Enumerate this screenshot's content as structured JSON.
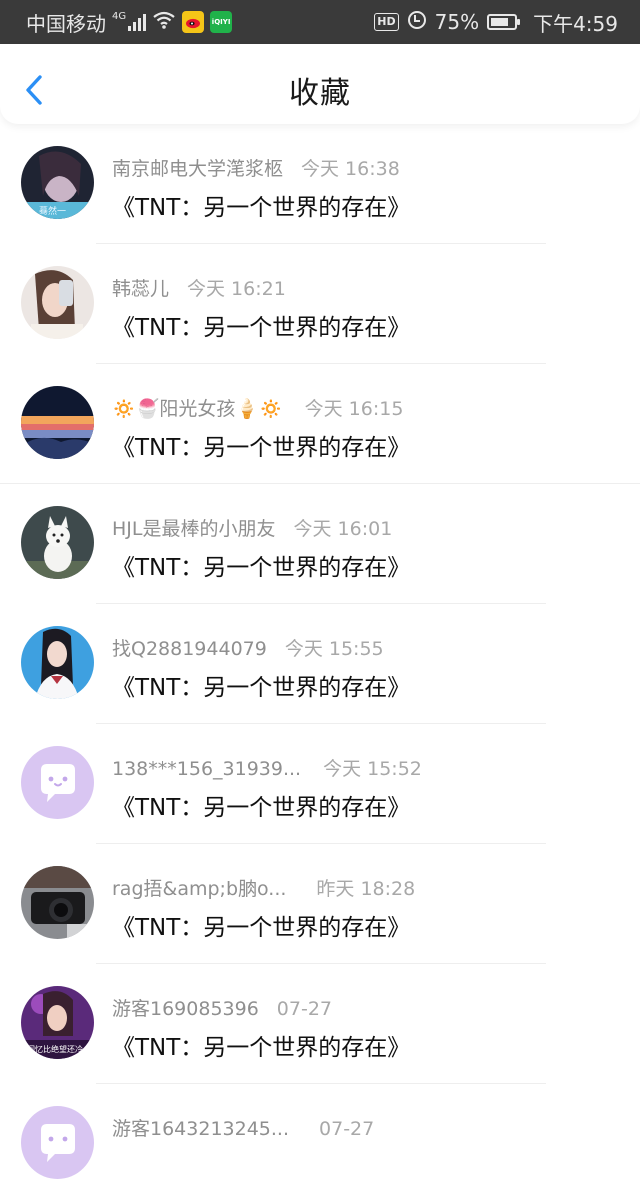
{
  "status_bar": {
    "carrier": "中国移动",
    "network": "4G",
    "battery_percent": "75%",
    "battery_level": 0.75,
    "time": "下午4:59",
    "hd_label": "HD",
    "iqiyi_label": "iQIYI"
  },
  "header": {
    "back_icon": "chevron-left-icon",
    "title": "收藏"
  },
  "favorites": [
    {
      "user": "南京邮电大学滗浆柩",
      "time": "今天 16:38",
      "title": "《TNT：另一个世界的存在》",
      "avatar": "photo-dark"
    },
    {
      "user": "韩蕊儿",
      "time": "今天 16:21",
      "title": "《TNT：另一个世界的存在》",
      "avatar": "photo-light"
    },
    {
      "user": "🔅🍧阳光女孩🍦🔅",
      "time": "今天 16:15",
      "title": "《TNT：另一个世界的存在》",
      "avatar": "photo-sunset"
    },
    {
      "user": "HJL是最棒的小朋友",
      "time": "今天 16:01",
      "title": "《TNT：另一个世界的存在》",
      "avatar": "photo-dog"
    },
    {
      "user": "找Q2881944079",
      "time": "今天 15:55",
      "title": "《TNT：另一个世界的存在》",
      "avatar": "photo-blue"
    },
    {
      "user": "138***156_31939...",
      "time": "今天 15:52",
      "title": "《TNT：另一个世界的存在》",
      "avatar": "default-chat"
    },
    {
      "user": "rag捂&amp;b朒o...",
      "time": "昨天 18:28",
      "title": "《TNT：另一个世界的存在》",
      "avatar": "photo-camera"
    },
    {
      "user": "游客169085396",
      "time": "07-27",
      "title": "《TNT：另一个世界的存在》",
      "avatar": "photo-purple"
    },
    {
      "user": "游客1643213245...",
      "time": "07-27",
      "title": "",
      "avatar": "default-chat"
    }
  ]
}
